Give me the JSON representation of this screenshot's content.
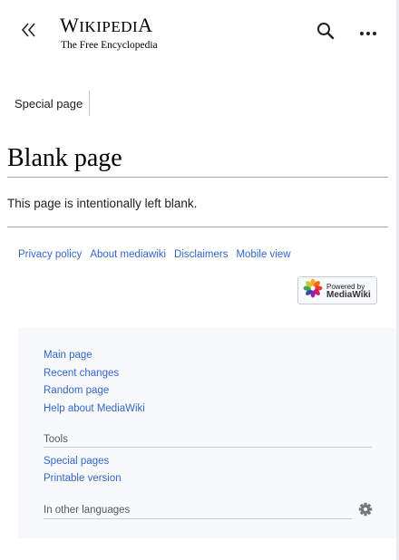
{
  "header": {
    "wordmark_main": "Wikipedia",
    "tagline": "The Free Encyclopedia",
    "icons": {
      "collapse": "double-chevron-left-icon",
      "search": "search-icon",
      "more": "ellipsis-icon"
    }
  },
  "tabs": [
    {
      "label": "Special page"
    }
  ],
  "main": {
    "title": "Blank page",
    "body": "This page is intentionally left blank."
  },
  "footer": {
    "links": [
      "Privacy policy",
      "About mediawiki",
      "Disclaimers",
      "Mobile view"
    ],
    "powered_line1": "Powered by",
    "powered_line2": "MediaWiki"
  },
  "sidebar": {
    "navigation": [
      "Main page",
      "Recent changes",
      "Random page",
      "Help about MediaWiki"
    ],
    "tools_heading": "Tools",
    "tools": [
      "Special pages",
      "Printable version"
    ],
    "languages_heading": "In other languages",
    "languages_icon": "gear-icon"
  },
  "colors": {
    "link": "#3366cc",
    "text": "#202122",
    "panel_bg": "#f8f9fa",
    "rule": "#a2a9b1"
  }
}
